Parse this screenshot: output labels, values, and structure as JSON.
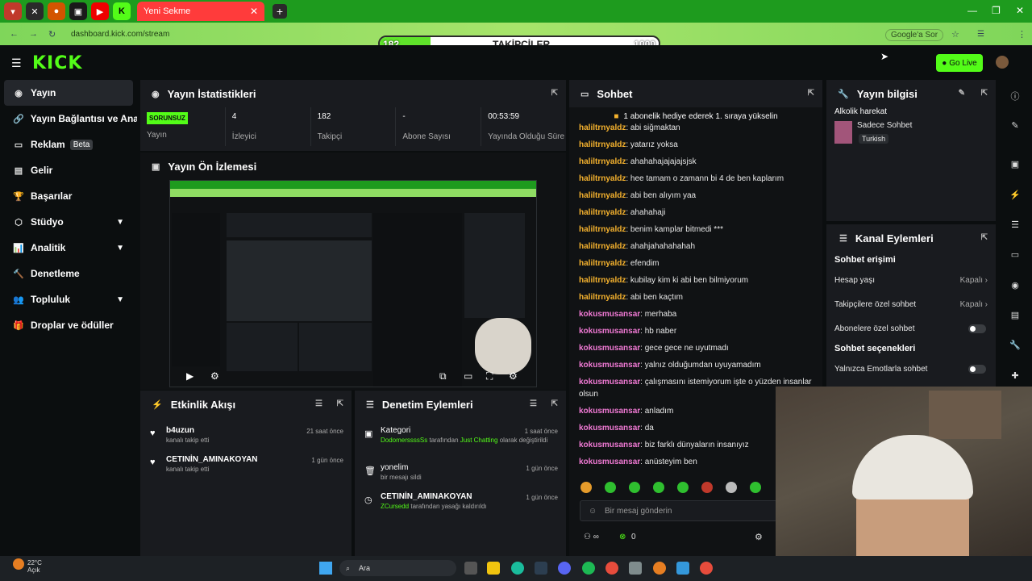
{
  "browser": {
    "tab_title": "Yeni Sekme",
    "url": "dashboard.kick.com/stream",
    "google": "Google'a Sor"
  },
  "follow_goal": {
    "label": "TAKİPÇİLER",
    "current": "182",
    "goal": "1000",
    "fraction": 0.182
  },
  "header": {
    "go_live": "Go Live"
  },
  "sidebar": {
    "items": [
      {
        "label": "Yayın",
        "icon": "stream-icon"
      },
      {
        "label": "Yayın Bağlantısı ve Anahtar",
        "icon": "link-icon"
      },
      {
        "label": "Reklam",
        "badge": "Beta",
        "icon": "ad-icon"
      },
      {
        "label": "Gelir",
        "icon": "money-icon"
      },
      {
        "label": "Başarılar",
        "icon": "trophy-icon"
      },
      {
        "label": "Stüdyo",
        "icon": "studio-icon"
      },
      {
        "label": "Analitik",
        "icon": "chart-icon"
      },
      {
        "label": "Denetleme",
        "icon": "hammer-icon"
      },
      {
        "label": "Topluluk",
        "icon": "community-icon"
      },
      {
        "label": "Droplar ve ödüller",
        "icon": "gift-icon"
      }
    ]
  },
  "stats": {
    "title": "Yayın İstatistikleri",
    "status": "SORUNSUZ",
    "status_label": "Yayın",
    "items": [
      {
        "value": "4",
        "label": "İzleyici"
      },
      {
        "value": "182",
        "label": "Takipçi"
      },
      {
        "value": "-",
        "label": "Abone Sayısı"
      },
      {
        "value": "00:53:59",
        "label": "Yayında Olduğu Süre"
      }
    ]
  },
  "preview": {
    "title": "Yayın Ön İzlemesi"
  },
  "activity": {
    "title": "Etkinlik Akışı",
    "items": [
      {
        "name": "b4uzun",
        "sub": "kanalı takip etti",
        "time": "21 saat önce"
      },
      {
        "name": "CETINİN_AMINAKOYAN",
        "sub": "kanalı takip etti",
        "time": "1 gün önce"
      }
    ]
  },
  "moderation": {
    "title": "Denetim Eylemleri",
    "items": [
      {
        "name": "Kategori",
        "user": "DodomerssssSs",
        "mid": "tarafından",
        "hl": "Just Chatting",
        "end": "olarak değiştirildi",
        "time": "1 saat önce"
      },
      {
        "name": "yonelim",
        "end": "bir mesajı sildi",
        "time": "1 gün önce"
      },
      {
        "name": "CETINİN_AMINAKOYAN",
        "user": "ZCursedd",
        "end": "tarafından yasağı kaldırıldı",
        "time": "1 gün önce"
      }
    ]
  },
  "chat": {
    "title": "Sohbet",
    "pinned": "1 abonelik hediye ederek 1. sıraya yükselin",
    "input_placeholder": "Bir mesaj gönderin",
    "count": "0",
    "messages": [
      {
        "user": "haliltrnyaldz",
        "text": "abi siğmaktan",
        "c": 1
      },
      {
        "user": "haliltrnyaldz",
        "text": "yatarız yoksa",
        "c": 1
      },
      {
        "user": "haliltrnyaldz",
        "text": "ahahahajajajajsjsk",
        "c": 1
      },
      {
        "user": "haliltrnyaldz",
        "text": "hee tamam o zamann bi 4 de ben kaplarım",
        "c": 1
      },
      {
        "user": "haliltrnyaldz",
        "text": "abi ben alıyım yaa",
        "c": 1
      },
      {
        "user": "haliltrnyaldz",
        "text": "ahahahaji",
        "c": 1
      },
      {
        "user": "haliltrnyaldz",
        "text": "benim kamplar bitmedi ***",
        "c": 1
      },
      {
        "user": "haliltrnyaldz",
        "text": "ahahjahahahahah",
        "c": 1
      },
      {
        "user": "haliltrnyaldz",
        "text": "efendim",
        "c": 1
      },
      {
        "user": "haliltrnyaldz",
        "text": "kubilay kim ki abi ben bilmiyorum",
        "c": 1
      },
      {
        "user": "haliltrnyaldz",
        "text": "abi ben kaçtım",
        "c": 1
      },
      {
        "user": "kokusmusansar",
        "text": "merhaba",
        "c": 2
      },
      {
        "user": "kokusmusansar",
        "text": "hb naber",
        "c": 2
      },
      {
        "user": "kokusmusansar",
        "text": "gece gece ne uyutmadı",
        "c": 2
      },
      {
        "user": "kokusmusansar",
        "text": "yalnız olduğumdan uyuyamadım",
        "c": 2
      },
      {
        "user": "kokusmusansar",
        "text": "çalışmasını istemiyorum işte o yüzden insanlar olsun",
        "c": 2
      },
      {
        "user": "kokusmusansar",
        "text": "anladım",
        "c": 2
      },
      {
        "user": "kokusmusansar",
        "text": "da",
        "c": 2
      },
      {
        "user": "kokusmusansar",
        "text": "biz farklı dünyaların insanıyız",
        "c": 2
      },
      {
        "user": "kokusmusansar",
        "text": "anüsteyim ben",
        "c": 2
      }
    ]
  },
  "info": {
    "title": "Yayın bilgisi",
    "stream_title": "Alkolik harekat",
    "category": "Sadece Sohbet",
    "tag": "Turkish"
  },
  "actions": {
    "title": "Kanal Eylemleri",
    "section1": "Sohbet erişimi",
    "rows": [
      {
        "label": "Hesap yaşı",
        "value": "Kapalı"
      },
      {
        "label": "Takipçilere özel sohbet",
        "value": "Kapalı"
      },
      {
        "label": "Abonelere özel sohbet"
      }
    ],
    "section2": "Sohbet seçenekleri",
    "row4": "Yalnızca Emotlarla sohbet"
  },
  "taskbar": {
    "temp": "22°C",
    "weather": "Açık",
    "search": "Ara"
  },
  "colors": {
    "accent": "#53fc18",
    "chrome_green": "#1e9b1e"
  }
}
